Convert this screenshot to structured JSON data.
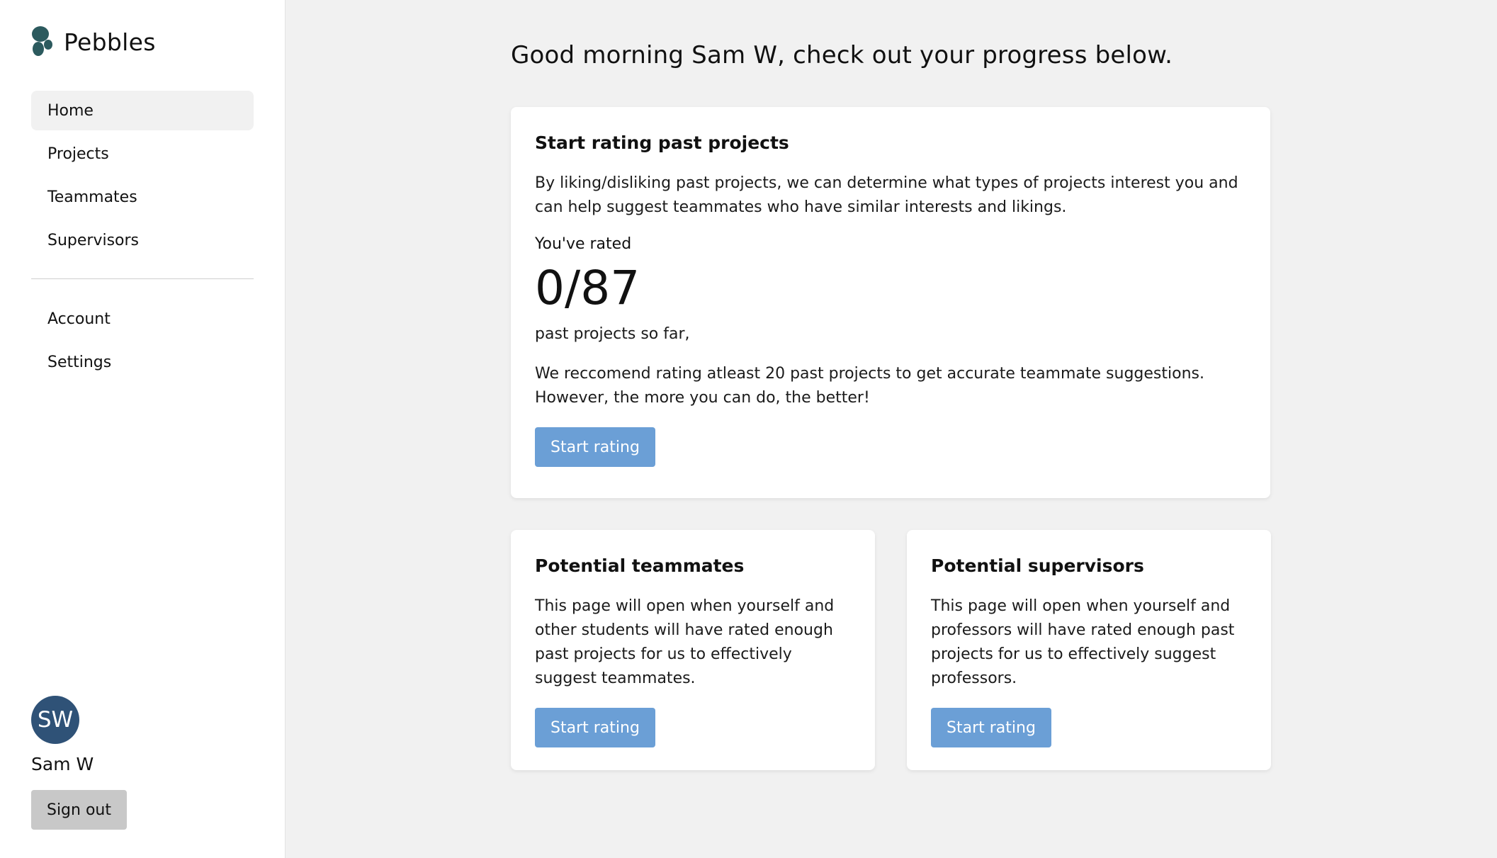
{
  "app": {
    "name": "Pebbles"
  },
  "sidebar": {
    "nav_items": [
      {
        "label": "Home"
      },
      {
        "label": "Projects"
      },
      {
        "label": "Teammates"
      },
      {
        "label": "Supervisors"
      }
    ],
    "secondary_items": [
      {
        "label": "Account"
      },
      {
        "label": "Settings"
      }
    ],
    "user": {
      "initials": "SW",
      "name": "Sam W",
      "signout_label": "Sign out"
    }
  },
  "main": {
    "greeting": "Good morning Sam W, check out your progress below.",
    "rating_card": {
      "title": "Start rating past projects",
      "description": "By liking/disliking past projects, we can determine what types of projects interest you and can help suggest teammates who have similar interests and likings.",
      "rated_label": "You've rated",
      "rated_count": "0/87",
      "rated_suffix": "past projects so far,",
      "recommendation": "We reccomend rating atleast 20 past projects to get accurate teammate suggestions. However, the more you can do, the better!",
      "button_label": "Start rating"
    },
    "teammates_card": {
      "title": "Potential teammates",
      "description": "This page will open when yourself and other students will have rated enough past projects for us to effectively suggest teammates.",
      "button_label": "Start rating"
    },
    "supervisors_card": {
      "title": "Potential supervisors",
      "description": "This page will open when yourself and professors will have rated enough past projects for us to effectively suggest professors.",
      "button_label": "Start rating"
    }
  },
  "colors": {
    "brand_icon": "#2c5a5e",
    "avatar_bg": "#2f5277",
    "primary_button": "#6b9fd6",
    "signout_button": "#c8c8c8",
    "page_bg": "#f1f1f1"
  }
}
